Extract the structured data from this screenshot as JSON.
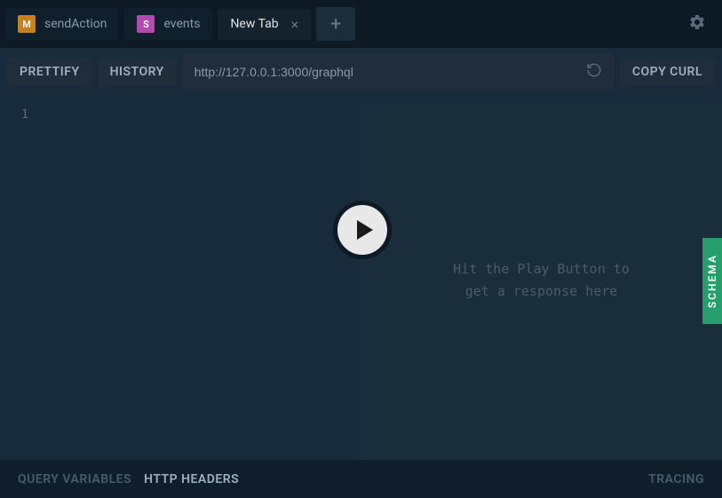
{
  "tabs": [
    {
      "badge": "M",
      "badgeColor": "orange",
      "label": "sendAction"
    },
    {
      "badge": "S",
      "badgeColor": "purple",
      "label": "events"
    },
    {
      "label": "New Tab",
      "closable": true,
      "active": true
    }
  ],
  "toolbar": {
    "prettify": "PRETTIFY",
    "history": "HISTORY",
    "url": "http://127.0.0.1:3000/graphql",
    "copyCurl": "COPY CURL"
  },
  "editor": {
    "lineNumber": "1"
  },
  "response": {
    "placeholder": "Hit the Play Button to\nget a response here"
  },
  "schema": {
    "label": "SCHEMA"
  },
  "bottomBar": {
    "queryVariables": "QUERY VARIABLES",
    "httpHeaders": "HTTP HEADERS",
    "tracing": "TRACING"
  }
}
